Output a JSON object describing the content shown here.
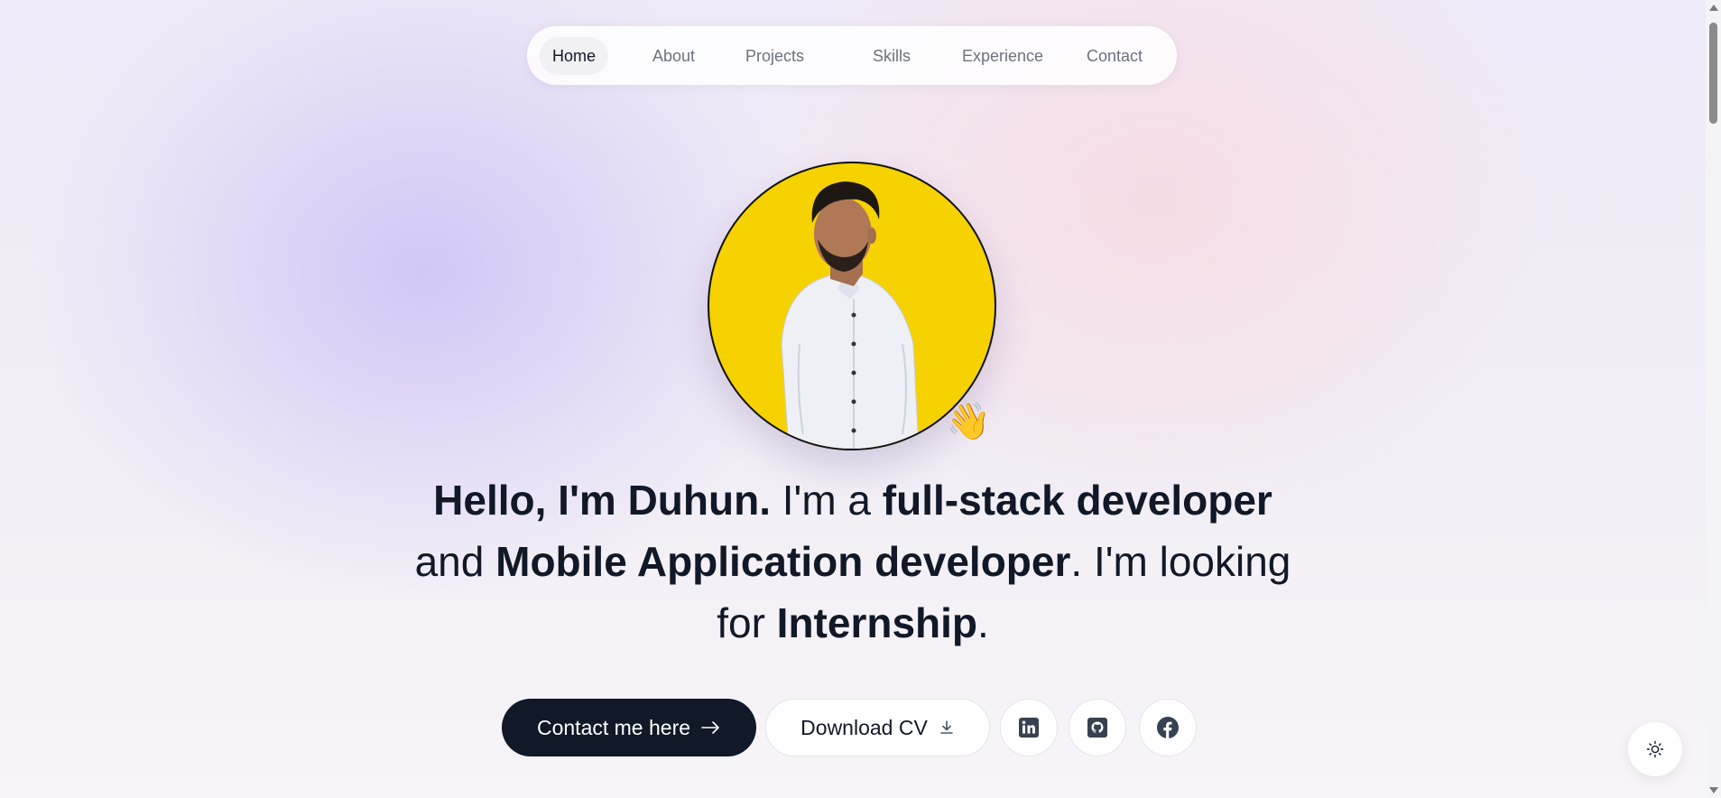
{
  "nav": {
    "items": [
      {
        "label": "Home",
        "active": true
      },
      {
        "label": "About"
      },
      {
        "label": "Projects"
      },
      {
        "label": "Skills"
      },
      {
        "label": "Experience"
      },
      {
        "label": "Contact"
      }
    ]
  },
  "hero": {
    "avatar_icon": "person-portrait-icon",
    "wave_emoji": "👋",
    "headline": {
      "greeting": "Hello, I'm Duhun.",
      "im_a": " I'm a ",
      "role1": "full-stack developer",
      "and": " and ",
      "role2": "Mobile Application developer",
      "looking": ". I'm looking for ",
      "goal": "Internship",
      "end": "."
    }
  },
  "actions": {
    "contact_label": "Contact me here",
    "contact_icon": "arrow-right-icon",
    "cv_label": "Download CV",
    "cv_icon": "download-icon",
    "social": [
      "linkedin-icon",
      "github-icon",
      "facebook-icon"
    ]
  },
  "theme_toggle": {
    "icon": "sun-icon"
  },
  "colors": {
    "primary": "#111827",
    "avatar_bg": "#f5d200",
    "muted_text": "#6b7280"
  }
}
